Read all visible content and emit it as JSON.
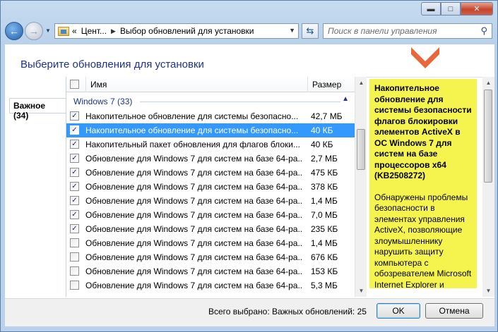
{
  "window": {
    "buttons": {
      "minimize": "▬",
      "maximize": "□",
      "close": "✕"
    }
  },
  "nav": {
    "address": {
      "chevrons": "«",
      "crumbs": [
        "Цент...",
        "Выбор обновлений для установки"
      ]
    },
    "search_placeholder": "Поиск в панели управления"
  },
  "page": {
    "heading": "Выберите обновления для установки",
    "left_tab": "Важное (34)"
  },
  "table": {
    "col_name": "Имя",
    "col_size": "Размер",
    "group_label": "Windows 7 (33)",
    "rows": [
      {
        "checked": true,
        "selected": false,
        "name": "Накопительное обновление для системы безопасно...",
        "size": "42,7 МБ"
      },
      {
        "checked": true,
        "selected": true,
        "name": "Накопительное обновление для системы безопасно...",
        "size": "40 КБ"
      },
      {
        "checked": true,
        "selected": false,
        "name": "Накопительный пакет обновления для флагов блоки...",
        "size": "40 КБ"
      },
      {
        "checked": true,
        "selected": false,
        "name": "Обновление для Windows 7 для систем на базе 64-ра...",
        "size": "2,7 МБ"
      },
      {
        "checked": true,
        "selected": false,
        "name": "Обновление для Windows 7 для систем на базе 64-ра...",
        "size": "475 КБ"
      },
      {
        "checked": true,
        "selected": false,
        "name": "Обновление для Windows 7 для систем на базе 64-ра...",
        "size": "378 КБ"
      },
      {
        "checked": true,
        "selected": false,
        "name": "Обновление для Windows 7 для систем на базе 64-ра...",
        "size": "1,4 МБ"
      },
      {
        "checked": true,
        "selected": false,
        "name": "Обновление для Windows 7 для систем на базе 64-ра...",
        "size": "7,0 МБ"
      },
      {
        "checked": true,
        "selected": false,
        "name": "Обновление для Windows 7 для систем на базе 64-ра...",
        "size": "235 КБ"
      },
      {
        "checked": false,
        "selected": false,
        "name": "Обновление для Windows 7 для систем на базе 64-ра...",
        "size": "1,4 МБ"
      },
      {
        "checked": false,
        "selected": false,
        "name": "Обновление для Windows 7 для систем на базе 64-ра...",
        "size": "676 КБ"
      },
      {
        "checked": false,
        "selected": false,
        "name": "Обновление для Windows 7 для систем на базе 64-ра...",
        "size": "153 КБ"
      },
      {
        "checked": false,
        "selected": false,
        "name": "Обновление для Windows 7 для систем на базе 64-ра...",
        "size": "5,3 МБ"
      }
    ]
  },
  "details": {
    "title": "Накопительное обновление для системы безопасности флагов блокировки элементов ActiveX в ОС Windows 7 для систем на базе процессоров x64 (KB2508272)",
    "body": "Обнаружены проблемы безопасности в элементах управления ActiveX, позволяющие злоумышленнику нарушить защиту компьютера с обозревателем Microsoft Internet Explorer и получить возможность управления компьютером. Чтобы защитить компьютер"
  },
  "footer": {
    "summary": "Всего выбрано: Важных обновлений: 25",
    "ok": "OK",
    "cancel": "Отмена"
  },
  "colors": {
    "selection": "#3399ff",
    "details_highlight": "#f5f34e",
    "arrow_marker": "#e8673a"
  }
}
